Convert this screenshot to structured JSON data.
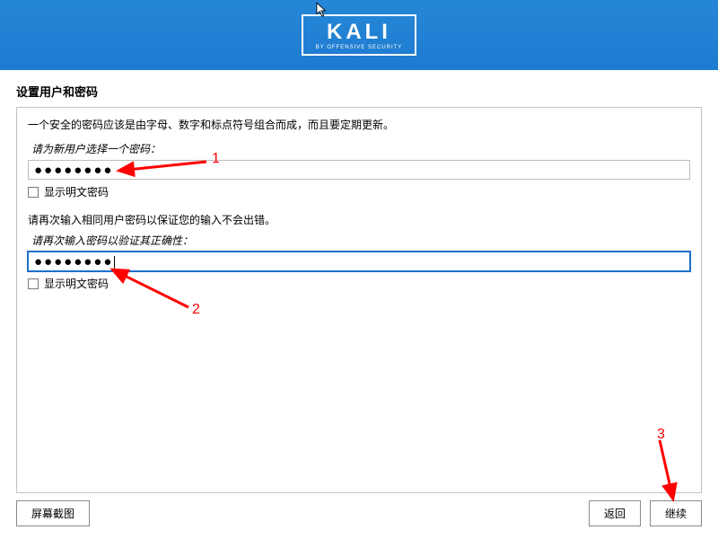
{
  "banner": {
    "logo_text": "KALI",
    "logo_subtext": "BY OFFENSIVE SECURITY"
  },
  "page_title": "设置用户和密码",
  "description": "一个安全的密码应该是由字母、数字和标点符号组合而成，而且要定期更新。",
  "password1": {
    "label": "请为新用户选择一个密码：",
    "value": "●●●●●●●●",
    "show_plain_label": "显示明文密码"
  },
  "confirm_desc": "请再次输入相同用户密码以保证您的输入不会出错。",
  "password2": {
    "label": "请再次输入密码以验证其正确性：",
    "value": "●●●●●●●●",
    "show_plain_label": "显示明文密码"
  },
  "footer": {
    "screenshot": "屏幕截图",
    "back": "返回",
    "continue": "继续"
  },
  "annotations": {
    "n1": "1",
    "n2": "2",
    "n3": "3"
  }
}
